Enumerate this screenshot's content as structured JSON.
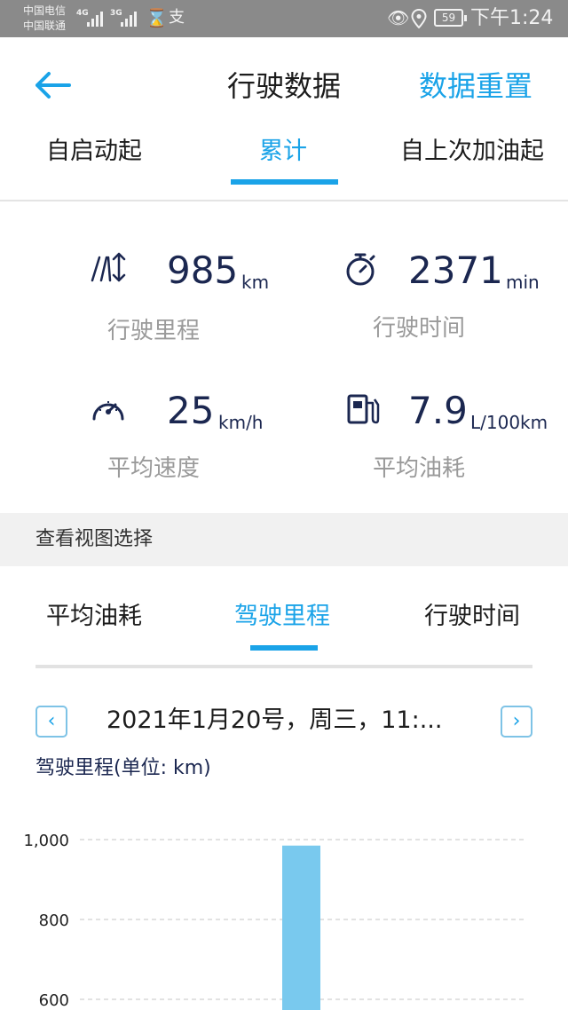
{
  "status_bar": {
    "carrier_1": "中国电信",
    "carrier_2": "中国联通",
    "net_1": "4G",
    "net_2": "3G",
    "battery": "59",
    "time": "下午1:24"
  },
  "header": {
    "back_icon": "arrow-left-icon",
    "title": "行驶数据",
    "reset_label": "数据重置",
    "accent_color": "#1aa3e8"
  },
  "period_tabs": [
    {
      "label": "自启动起",
      "active": false
    },
    {
      "label": "累计",
      "active": true
    },
    {
      "label": "自上次加油起",
      "active": false
    }
  ],
  "stats": [
    {
      "icon": "road-distance-icon",
      "value": "985",
      "unit": "km",
      "label": "行驶里程"
    },
    {
      "icon": "stopwatch-icon",
      "value": "2371",
      "unit": "min",
      "label": "行驶时间"
    },
    {
      "icon": "speedometer-icon",
      "value": "25",
      "unit": "km/h",
      "label": "平均速度"
    },
    {
      "icon": "fuel-pump-icon",
      "value": "7.9",
      "unit": "L/100km",
      "label": "平均油耗"
    }
  ],
  "view_section": {
    "label": "查看视图选择"
  },
  "view_tabs": [
    {
      "label": "平均油耗",
      "active": false
    },
    {
      "label": "驾驶里程",
      "active": true
    },
    {
      "label": "行驶时间",
      "active": false
    }
  ],
  "date_nav": {
    "prev_icon": "chevron-left-icon",
    "next_icon": "chevron-right-icon",
    "text": "2021年1月20号，周三，11:..."
  },
  "chart_data": {
    "type": "bar",
    "title": "驾驶里程(单位: km)",
    "categories": [
      ""
    ],
    "values": [
      985
    ],
    "ticks": [
      600,
      800,
      1000
    ],
    "tick_labels": [
      "600",
      "800",
      "1,000"
    ],
    "bar_color": "#79c9ee",
    "grid": true
  }
}
